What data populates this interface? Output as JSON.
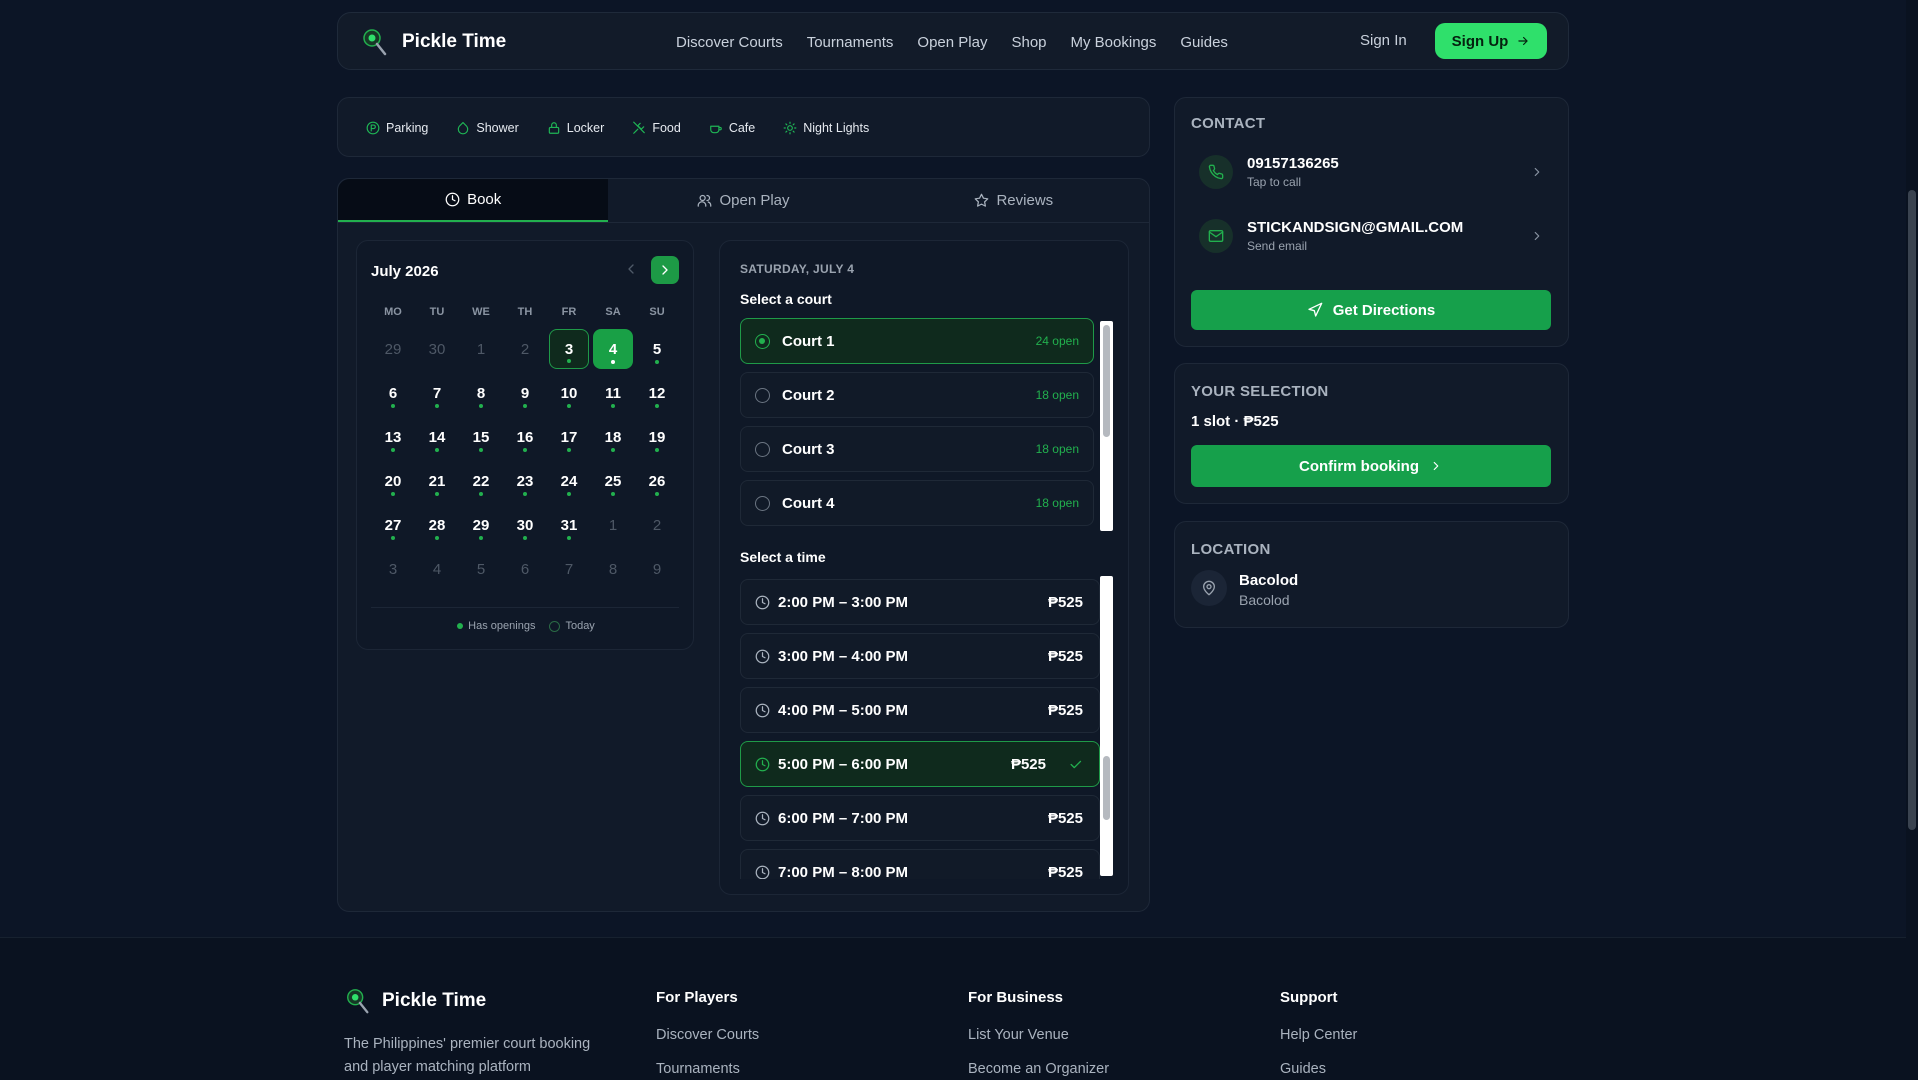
{
  "header": {
    "brand": "Pickle Time",
    "nav": [
      "Discover Courts",
      "Tournaments",
      "Open Play",
      "Shop",
      "My Bookings",
      "Guides"
    ],
    "sign_in": "Sign In",
    "sign_up": "Sign Up"
  },
  "amenities": [
    {
      "label": "Parking",
      "icon": "parking-icon"
    },
    {
      "label": "Shower",
      "icon": "droplet-icon"
    },
    {
      "label": "Locker",
      "icon": "lock-icon"
    },
    {
      "label": "Food",
      "icon": "utensils-icon"
    },
    {
      "label": "Cafe",
      "icon": "coffee-icon"
    },
    {
      "label": "Night Lights",
      "icon": "sun-icon"
    }
  ],
  "tabs": [
    {
      "label": "Book",
      "icon": "clock-icon",
      "active": true
    },
    {
      "label": "Open Play",
      "icon": "users-icon",
      "active": false
    },
    {
      "label": "Reviews",
      "icon": "star-icon",
      "active": false
    }
  ],
  "calendar": {
    "month": "July 2026",
    "weekdays": [
      "MO",
      "TU",
      "WE",
      "TH",
      "FR",
      "SA",
      "SU"
    ],
    "days": [
      {
        "d": "29",
        "m": true
      },
      {
        "d": "30",
        "m": true
      },
      {
        "d": "1",
        "m": true
      },
      {
        "d": "2",
        "m": true
      },
      {
        "d": "3",
        "has": true,
        "today": true
      },
      {
        "d": "4",
        "has": true,
        "sel": true
      },
      {
        "d": "5",
        "has": true
      },
      {
        "d": "6",
        "has": true
      },
      {
        "d": "7",
        "has": true
      },
      {
        "d": "8",
        "has": true
      },
      {
        "d": "9",
        "has": true
      },
      {
        "d": "10",
        "has": true
      },
      {
        "d": "11",
        "has": true
      },
      {
        "d": "12",
        "has": true
      },
      {
        "d": "13",
        "has": true
      },
      {
        "d": "14",
        "has": true
      },
      {
        "d": "15",
        "has": true
      },
      {
        "d": "16",
        "has": true
      },
      {
        "d": "17",
        "has": true
      },
      {
        "d": "18",
        "has": true
      },
      {
        "d": "19",
        "has": true
      },
      {
        "d": "20",
        "has": true
      },
      {
        "d": "21",
        "has": true
      },
      {
        "d": "22",
        "has": true
      },
      {
        "d": "23",
        "has": true
      },
      {
        "d": "24",
        "has": true
      },
      {
        "d": "25",
        "has": true
      },
      {
        "d": "26",
        "has": true
      },
      {
        "d": "27",
        "has": true
      },
      {
        "d": "28",
        "has": true
      },
      {
        "d": "29",
        "has": true
      },
      {
        "d": "30",
        "has": true
      },
      {
        "d": "31",
        "has": true
      },
      {
        "d": "1",
        "m": true
      },
      {
        "d": "2",
        "m": true
      },
      {
        "d": "3",
        "m": true
      },
      {
        "d": "4",
        "m": true
      },
      {
        "d": "5",
        "m": true
      },
      {
        "d": "6",
        "m": true
      },
      {
        "d": "7",
        "m": true
      },
      {
        "d": "8",
        "m": true
      },
      {
        "d": "9",
        "m": true
      }
    ],
    "legend_openings": "Has openings",
    "legend_today": "Today"
  },
  "booking": {
    "date": "SATURDAY, JULY 4",
    "select_court": "Select a court",
    "courts": [
      {
        "name": "Court 1",
        "open": "24 open",
        "selected": true
      },
      {
        "name": "Court 2",
        "open": "18 open",
        "selected": false
      },
      {
        "name": "Court 3",
        "open": "18 open",
        "selected": false
      },
      {
        "name": "Court 4",
        "open": "18 open",
        "selected": false
      }
    ],
    "select_time": "Select a time",
    "times": [
      {
        "label": "2:00 PM – 3:00 PM",
        "price": "₱525",
        "selected": false
      },
      {
        "label": "3:00 PM – 4:00 PM",
        "price": "₱525",
        "selected": false
      },
      {
        "label": "4:00 PM – 5:00 PM",
        "price": "₱525",
        "selected": false
      },
      {
        "label": "5:00 PM – 6:00 PM",
        "price": "₱525",
        "selected": true
      },
      {
        "label": "6:00 PM – 7:00 PM",
        "price": "₱525",
        "selected": false
      },
      {
        "label": "7:00 PM – 8:00 PM",
        "price": "₱525",
        "selected": false
      }
    ]
  },
  "contact": {
    "title": "CONTACT",
    "phone": "09157136265",
    "phone_sub": "Tap to call",
    "email": "STICKANDSIGN@GMAIL.COM",
    "email_sub": "Send email",
    "directions": "Get Directions"
  },
  "selection": {
    "title": "YOUR SELECTION",
    "summary": "1 slot · ₱525",
    "confirm": "Confirm booking"
  },
  "location": {
    "title": "LOCATION",
    "name": "Bacolod",
    "sub": "Bacolod"
  },
  "footer": {
    "brand": "Pickle Time",
    "tagline1": "The Philippines' premier court booking",
    "tagline2": "and player matching platform",
    "players_title": "For Players",
    "players_links": [
      "Discover Courts",
      "Tournaments"
    ],
    "business_title": "For Business",
    "business_links": [
      "List Your Venue",
      "Become an Organizer"
    ],
    "support_title": "Support",
    "support_links": [
      "Help Center",
      "Guides"
    ]
  },
  "colors": {
    "accent": "#22b04e",
    "signup": "#2fe06b",
    "bg": "#0c1526"
  }
}
